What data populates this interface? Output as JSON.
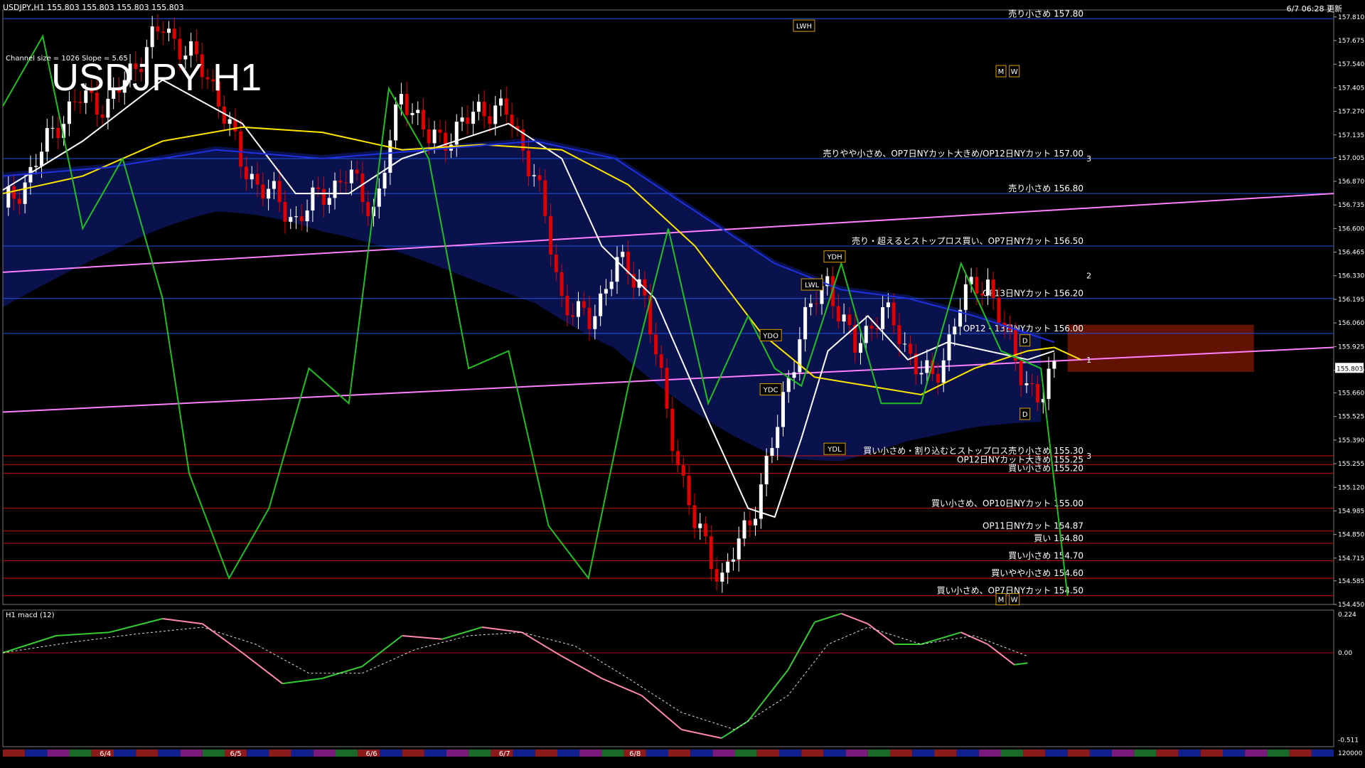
{
  "header": {
    "symbol_info": "USDJPY,H1  155.803 155.803 155.803 155.803",
    "timestamp": "6/7 06:28 更新",
    "channel_info": "Channel size = 1026 Slope = 5.65",
    "big_title": "USDJPY H1"
  },
  "macd_label": "H1  macd (12)",
  "colors": {
    "background": "#000000",
    "bull_candle": "#ffffff",
    "bear_candle": "#e00000",
    "ma_white": "#ffffff",
    "ma_yellow": "#ffe500",
    "ma_blue": "#2030e0",
    "channel": "#ff80ff",
    "green_line": "#20c020",
    "level_line_blue": "#2255dd",
    "level_line_red": "#cc1111",
    "label_box": "#d8a000"
  },
  "chart_data": {
    "type": "line",
    "instrument": "USDJPY",
    "timeframe": "H1",
    "current_price": 155.803,
    "ylim": [
      154.45,
      157.85
    ],
    "y_ticks": [
      "157.810",
      "157.675",
      "157.540",
      "157.405",
      "157.270",
      "157.135",
      "157.005",
      "156.870",
      "156.735",
      "156.600",
      "156.465",
      "156.330",
      "156.195",
      "156.060",
      "155.925",
      "155.790",
      "155.660",
      "155.525",
      "155.390",
      "155.255",
      "155.120",
      "154.985",
      "154.850",
      "154.715",
      "154.585",
      "154.450"
    ],
    "x_labels": [
      "6/4",
      "6/5",
      "6/6",
      "6/7",
      "6/8"
    ],
    "x_label_rel": [
      0.077,
      0.175,
      0.277,
      0.377,
      0.475
    ],
    "close_path": [
      {
        "t": 0.0,
        "p": 156.72
      },
      {
        "t": 0.02,
        "p": 156.9
      },
      {
        "t": 0.04,
        "p": 157.2
      },
      {
        "t": 0.06,
        "p": 157.35
      },
      {
        "t": 0.08,
        "p": 157.3
      },
      {
        "t": 0.1,
        "p": 157.55
      },
      {
        "t": 0.12,
        "p": 157.75
      },
      {
        "t": 0.14,
        "p": 157.6
      },
      {
        "t": 0.16,
        "p": 157.4
      },
      {
        "t": 0.18,
        "p": 156.95
      },
      {
        "t": 0.2,
        "p": 156.8
      },
      {
        "t": 0.22,
        "p": 156.65
      },
      {
        "t": 0.24,
        "p": 156.8
      },
      {
        "t": 0.26,
        "p": 156.9
      },
      {
        "t": 0.28,
        "p": 156.7
      },
      {
        "t": 0.3,
        "p": 157.4
      },
      {
        "t": 0.32,
        "p": 157.1
      },
      {
        "t": 0.34,
        "p": 157.15
      },
      {
        "t": 0.36,
        "p": 157.3
      },
      {
        "t": 0.38,
        "p": 157.25
      },
      {
        "t": 0.4,
        "p": 156.9
      },
      {
        "t": 0.42,
        "p": 156.2
      },
      {
        "t": 0.44,
        "p": 156.05
      },
      {
        "t": 0.46,
        "p": 156.4
      },
      {
        "t": 0.48,
        "p": 156.3
      },
      {
        "t": 0.5,
        "p": 155.5
      },
      {
        "t": 0.52,
        "p": 154.9
      },
      {
        "t": 0.54,
        "p": 154.6
      },
      {
        "t": 0.56,
        "p": 154.9
      },
      {
        "t": 0.58,
        "p": 155.4
      },
      {
        "t": 0.6,
        "p": 156.05
      },
      {
        "t": 0.62,
        "p": 156.3
      },
      {
        "t": 0.64,
        "p": 155.9
      },
      {
        "t": 0.66,
        "p": 156.15
      },
      {
        "t": 0.68,
        "p": 155.9
      },
      {
        "t": 0.7,
        "p": 155.7
      },
      {
        "t": 0.72,
        "p": 156.2
      },
      {
        "t": 0.74,
        "p": 156.3
      },
      {
        "t": 0.76,
        "p": 155.85
      },
      {
        "t": 0.78,
        "p": 155.6
      },
      {
        "t": 0.79,
        "p": 155.8
      }
    ],
    "series": [
      {
        "name": "",
        "color": "#ffffff",
        "values": [
          {
            "t": 0.0,
            "p": 156.82
          },
          {
            "t": 0.06,
            "p": 157.1
          },
          {
            "t": 0.12,
            "p": 157.45
          },
          {
            "t": 0.18,
            "p": 157.2
          },
          {
            "t": 0.22,
            "p": 156.8
          },
          {
            "t": 0.26,
            "p": 156.8
          },
          {
            "t": 0.3,
            "p": 157.0
          },
          {
            "t": 0.34,
            "p": 157.1
          },
          {
            "t": 0.38,
            "p": 157.2
          },
          {
            "t": 0.42,
            "p": 157.0
          },
          {
            "t": 0.45,
            "p": 156.5
          },
          {
            "t": 0.49,
            "p": 156.2
          },
          {
            "t": 0.53,
            "p": 155.5
          },
          {
            "t": 0.56,
            "p": 155.0
          },
          {
            "t": 0.58,
            "p": 154.95
          },
          {
            "t": 0.6,
            "p": 155.4
          },
          {
            "t": 0.62,
            "p": 155.9
          },
          {
            "t": 0.65,
            "p": 156.1
          },
          {
            "t": 0.68,
            "p": 155.85
          },
          {
            "t": 0.71,
            "p": 155.95
          },
          {
            "t": 0.74,
            "p": 155.9
          },
          {
            "t": 0.77,
            "p": 155.85
          },
          {
            "t": 0.79,
            "p": 155.9
          }
        ]
      },
      {
        "name": "",
        "color": "#ffe500",
        "values": [
          {
            "t": 0.0,
            "p": 156.8
          },
          {
            "t": 0.06,
            "p": 156.9
          },
          {
            "t": 0.12,
            "p": 157.1
          },
          {
            "t": 0.18,
            "p": 157.18
          },
          {
            "t": 0.24,
            "p": 157.15
          },
          {
            "t": 0.3,
            "p": 157.05
          },
          {
            "t": 0.36,
            "p": 157.08
          },
          {
            "t": 0.42,
            "p": 157.05
          },
          {
            "t": 0.47,
            "p": 156.85
          },
          {
            "t": 0.52,
            "p": 156.5
          },
          {
            "t": 0.57,
            "p": 156.0
          },
          {
            "t": 0.61,
            "p": 155.75
          },
          {
            "t": 0.65,
            "p": 155.7
          },
          {
            "t": 0.69,
            "p": 155.65
          },
          {
            "t": 0.73,
            "p": 155.8
          },
          {
            "t": 0.77,
            "p": 155.9
          },
          {
            "t": 0.79,
            "p": 155.92
          },
          {
            "t": 0.81,
            "p": 155.85
          }
        ]
      },
      {
        "name": "",
        "color": "#2030e0",
        "values": [
          {
            "t": 0.0,
            "p": 156.9
          },
          {
            "t": 0.08,
            "p": 156.95
          },
          {
            "t": 0.16,
            "p": 157.05
          },
          {
            "t": 0.24,
            "p": 157.0
          },
          {
            "t": 0.32,
            "p": 157.05
          },
          {
            "t": 0.4,
            "p": 157.1
          },
          {
            "t": 0.46,
            "p": 157.0
          },
          {
            "t": 0.52,
            "p": 156.7
          },
          {
            "t": 0.58,
            "p": 156.4
          },
          {
            "t": 0.63,
            "p": 156.25
          },
          {
            "t": 0.68,
            "p": 156.2
          },
          {
            "t": 0.73,
            "p": 156.1
          },
          {
            "t": 0.77,
            "p": 156.0
          },
          {
            "t": 0.79,
            "p": 155.95
          }
        ]
      },
      {
        "name": "",
        "color": "#20c020",
        "values": [
          {
            "t": 0.0,
            "p": 157.3
          },
          {
            "t": 0.03,
            "p": 157.7
          },
          {
            "t": 0.06,
            "p": 156.6
          },
          {
            "t": 0.09,
            "p": 157.0
          },
          {
            "t": 0.12,
            "p": 156.2
          },
          {
            "t": 0.14,
            "p": 155.2
          },
          {
            "t": 0.17,
            "p": 154.6
          },
          {
            "t": 0.2,
            "p": 155.0
          },
          {
            "t": 0.23,
            "p": 155.8
          },
          {
            "t": 0.26,
            "p": 155.6
          },
          {
            "t": 0.29,
            "p": 157.4
          },
          {
            "t": 0.32,
            "p": 157.0
          },
          {
            "t": 0.35,
            "p": 155.8
          },
          {
            "t": 0.38,
            "p": 155.9
          },
          {
            "t": 0.41,
            "p": 154.9
          },
          {
            "t": 0.44,
            "p": 154.6
          },
          {
            "t": 0.47,
            "p": 155.7
          },
          {
            "t": 0.5,
            "p": 156.6
          },
          {
            "t": 0.53,
            "p": 155.6
          },
          {
            "t": 0.56,
            "p": 156.1
          },
          {
            "t": 0.58,
            "p": 155.8
          },
          {
            "t": 0.6,
            "p": 155.7
          },
          {
            "t": 0.63,
            "p": 156.4
          },
          {
            "t": 0.66,
            "p": 155.6
          },
          {
            "t": 0.69,
            "p": 155.6
          },
          {
            "t": 0.72,
            "p": 156.4
          },
          {
            "t": 0.75,
            "p": 155.9
          },
          {
            "t": 0.78,
            "p": 155.8
          },
          {
            "t": 0.8,
            "p": 154.5
          }
        ]
      }
    ],
    "channel_lines": [
      {
        "t0": 0.0,
        "p0": 155.55,
        "t1": 1.0,
        "p1": 155.92
      },
      {
        "t0": 0.0,
        "p0": 156.35,
        "t1": 1.0,
        "p1": 156.8
      }
    ],
    "level_lines": [
      {
        "price": 157.8,
        "label": "売り小さめ 157.80",
        "color": "#2255dd"
      },
      {
        "price": 157.0,
        "label": "売りやや小さめ、OP7日NYカット大きめ/OP12日NYカット 157.00",
        "color": "#2255dd"
      },
      {
        "price": 156.8,
        "label": "売り小さめ 156.80",
        "color": "#2255dd"
      },
      {
        "price": 156.5,
        "label": "売り・超えるとストップロス買い、OP7日NYカット 156.50",
        "color": "#2255dd"
      },
      {
        "price": 156.2,
        "label": "OP13日NYカット 156.20",
        "color": "#2255dd"
      },
      {
        "price": 156.0,
        "label": "OP12・13日NYカット 156.00",
        "color": "#2255dd"
      },
      {
        "price": 155.3,
        "label": "買い小さめ・割り込むとストップロス売り小さめ 155.30",
        "color": "#cc1111"
      },
      {
        "price": 155.25,
        "label": "OP12日NYカット大きめ 155.25",
        "color": "#cc1111"
      },
      {
        "price": 155.2,
        "label": "買い小さめ 155.20",
        "color": "#cc1111"
      },
      {
        "price": 155.0,
        "label": "買い小さめ、OP10日NYカット 155.00",
        "color": "#cc1111"
      },
      {
        "price": 154.87,
        "label": "OP11日NYカット 154.87",
        "color": "#cc1111"
      },
      {
        "price": 154.8,
        "label": "買い 154.80",
        "color": "#cc1111"
      },
      {
        "price": 154.7,
        "label": "買い小さめ 154.70",
        "color": "#cc1111"
      },
      {
        "price": 154.6,
        "label": "買いやや小さめ 154.60",
        "color": "#cc1111"
      },
      {
        "price": 154.5,
        "label": "買い小さめ、OP7日NYカット 154.50",
        "color": "#cc1111"
      }
    ],
    "boxes": [
      {
        "label": "LWH",
        "t": 0.602,
        "p": 157.76
      },
      {
        "label": "M",
        "t": 0.75,
        "p": 157.5
      },
      {
        "label": "W",
        "t": 0.76,
        "p": 157.5
      },
      {
        "label": "YDH",
        "t": 0.625,
        "p": 156.44
      },
      {
        "label": "LWL",
        "t": 0.608,
        "p": 156.28
      },
      {
        "label": "YDO",
        "t": 0.577,
        "p": 155.99
      },
      {
        "label": "YDC",
        "t": 0.577,
        "p": 155.68
      },
      {
        "label": "YDL",
        "t": 0.625,
        "p": 155.34
      },
      {
        "label": "D",
        "t": 0.768,
        "p": 155.96
      },
      {
        "label": "D",
        "t": 0.768,
        "p": 155.54
      },
      {
        "label": "M",
        "t": 0.75,
        "p": 154.48
      },
      {
        "label": "W",
        "t": 0.76,
        "p": 154.48
      }
    ],
    "projection_labels": [
      {
        "label": "3",
        "t": 0.812,
        "p": 157.0
      },
      {
        "label": "2",
        "t": 0.812,
        "p": 156.33
      },
      {
        "label": "1",
        "t": 0.812,
        "p": 155.85
      },
      {
        "label": "3",
        "t": 0.812,
        "p": 155.3
      }
    ],
    "macd": {
      "ylim": [
        -0.55,
        0.25
      ],
      "y_ticks": [
        "0.224",
        "0.00",
        "-0.511"
      ],
      "bottom_tick": "120000",
      "main": [
        {
          "t": 0.0,
          "v": 0.0
        },
        {
          "t": 0.04,
          "v": 0.1
        },
        {
          "t": 0.08,
          "v": 0.12
        },
        {
          "t": 0.12,
          "v": 0.2
        },
        {
          "t": 0.15,
          "v": 0.17
        },
        {
          "t": 0.18,
          "v": 0.0
        },
        {
          "t": 0.21,
          "v": -0.18
        },
        {
          "t": 0.24,
          "v": -0.15
        },
        {
          "t": 0.27,
          "v": -0.08
        },
        {
          "t": 0.3,
          "v": 0.1
        },
        {
          "t": 0.33,
          "v": 0.08
        },
        {
          "t": 0.36,
          "v": 0.15
        },
        {
          "t": 0.39,
          "v": 0.12
        },
        {
          "t": 0.42,
          "v": -0.02
        },
        {
          "t": 0.45,
          "v": -0.15
        },
        {
          "t": 0.48,
          "v": -0.25
        },
        {
          "t": 0.51,
          "v": -0.45
        },
        {
          "t": 0.54,
          "v": -0.5
        },
        {
          "t": 0.56,
          "v": -0.4
        },
        {
          "t": 0.59,
          "v": -0.1
        },
        {
          "t": 0.61,
          "v": 0.18
        },
        {
          "t": 0.63,
          "v": 0.23
        },
        {
          "t": 0.65,
          "v": 0.17
        },
        {
          "t": 0.67,
          "v": 0.05
        },
        {
          "t": 0.69,
          "v": 0.05
        },
        {
          "t": 0.72,
          "v": 0.12
        },
        {
          "t": 0.74,
          "v": 0.05
        },
        {
          "t": 0.76,
          "v": -0.07
        },
        {
          "t": 0.77,
          "v": -0.06
        }
      ],
      "signal": [
        {
          "t": 0.0,
          "v": 0.0
        },
        {
          "t": 0.05,
          "v": 0.06
        },
        {
          "t": 0.1,
          "v": 0.11
        },
        {
          "t": 0.15,
          "v": 0.15
        },
        {
          "t": 0.19,
          "v": 0.05
        },
        {
          "t": 0.23,
          "v": -0.12
        },
        {
          "t": 0.27,
          "v": -0.12
        },
        {
          "t": 0.31,
          "v": 0.02
        },
        {
          "t": 0.35,
          "v": 0.1
        },
        {
          "t": 0.39,
          "v": 0.12
        },
        {
          "t": 0.43,
          "v": 0.04
        },
        {
          "t": 0.47,
          "v": -0.15
        },
        {
          "t": 0.51,
          "v": -0.35
        },
        {
          "t": 0.55,
          "v": -0.45
        },
        {
          "t": 0.59,
          "v": -0.25
        },
        {
          "t": 0.62,
          "v": 0.05
        },
        {
          "t": 0.65,
          "v": 0.15
        },
        {
          "t": 0.69,
          "v": 0.05
        },
        {
          "t": 0.73,
          "v": 0.1
        },
        {
          "t": 0.77,
          "v": -0.02
        }
      ]
    }
  }
}
